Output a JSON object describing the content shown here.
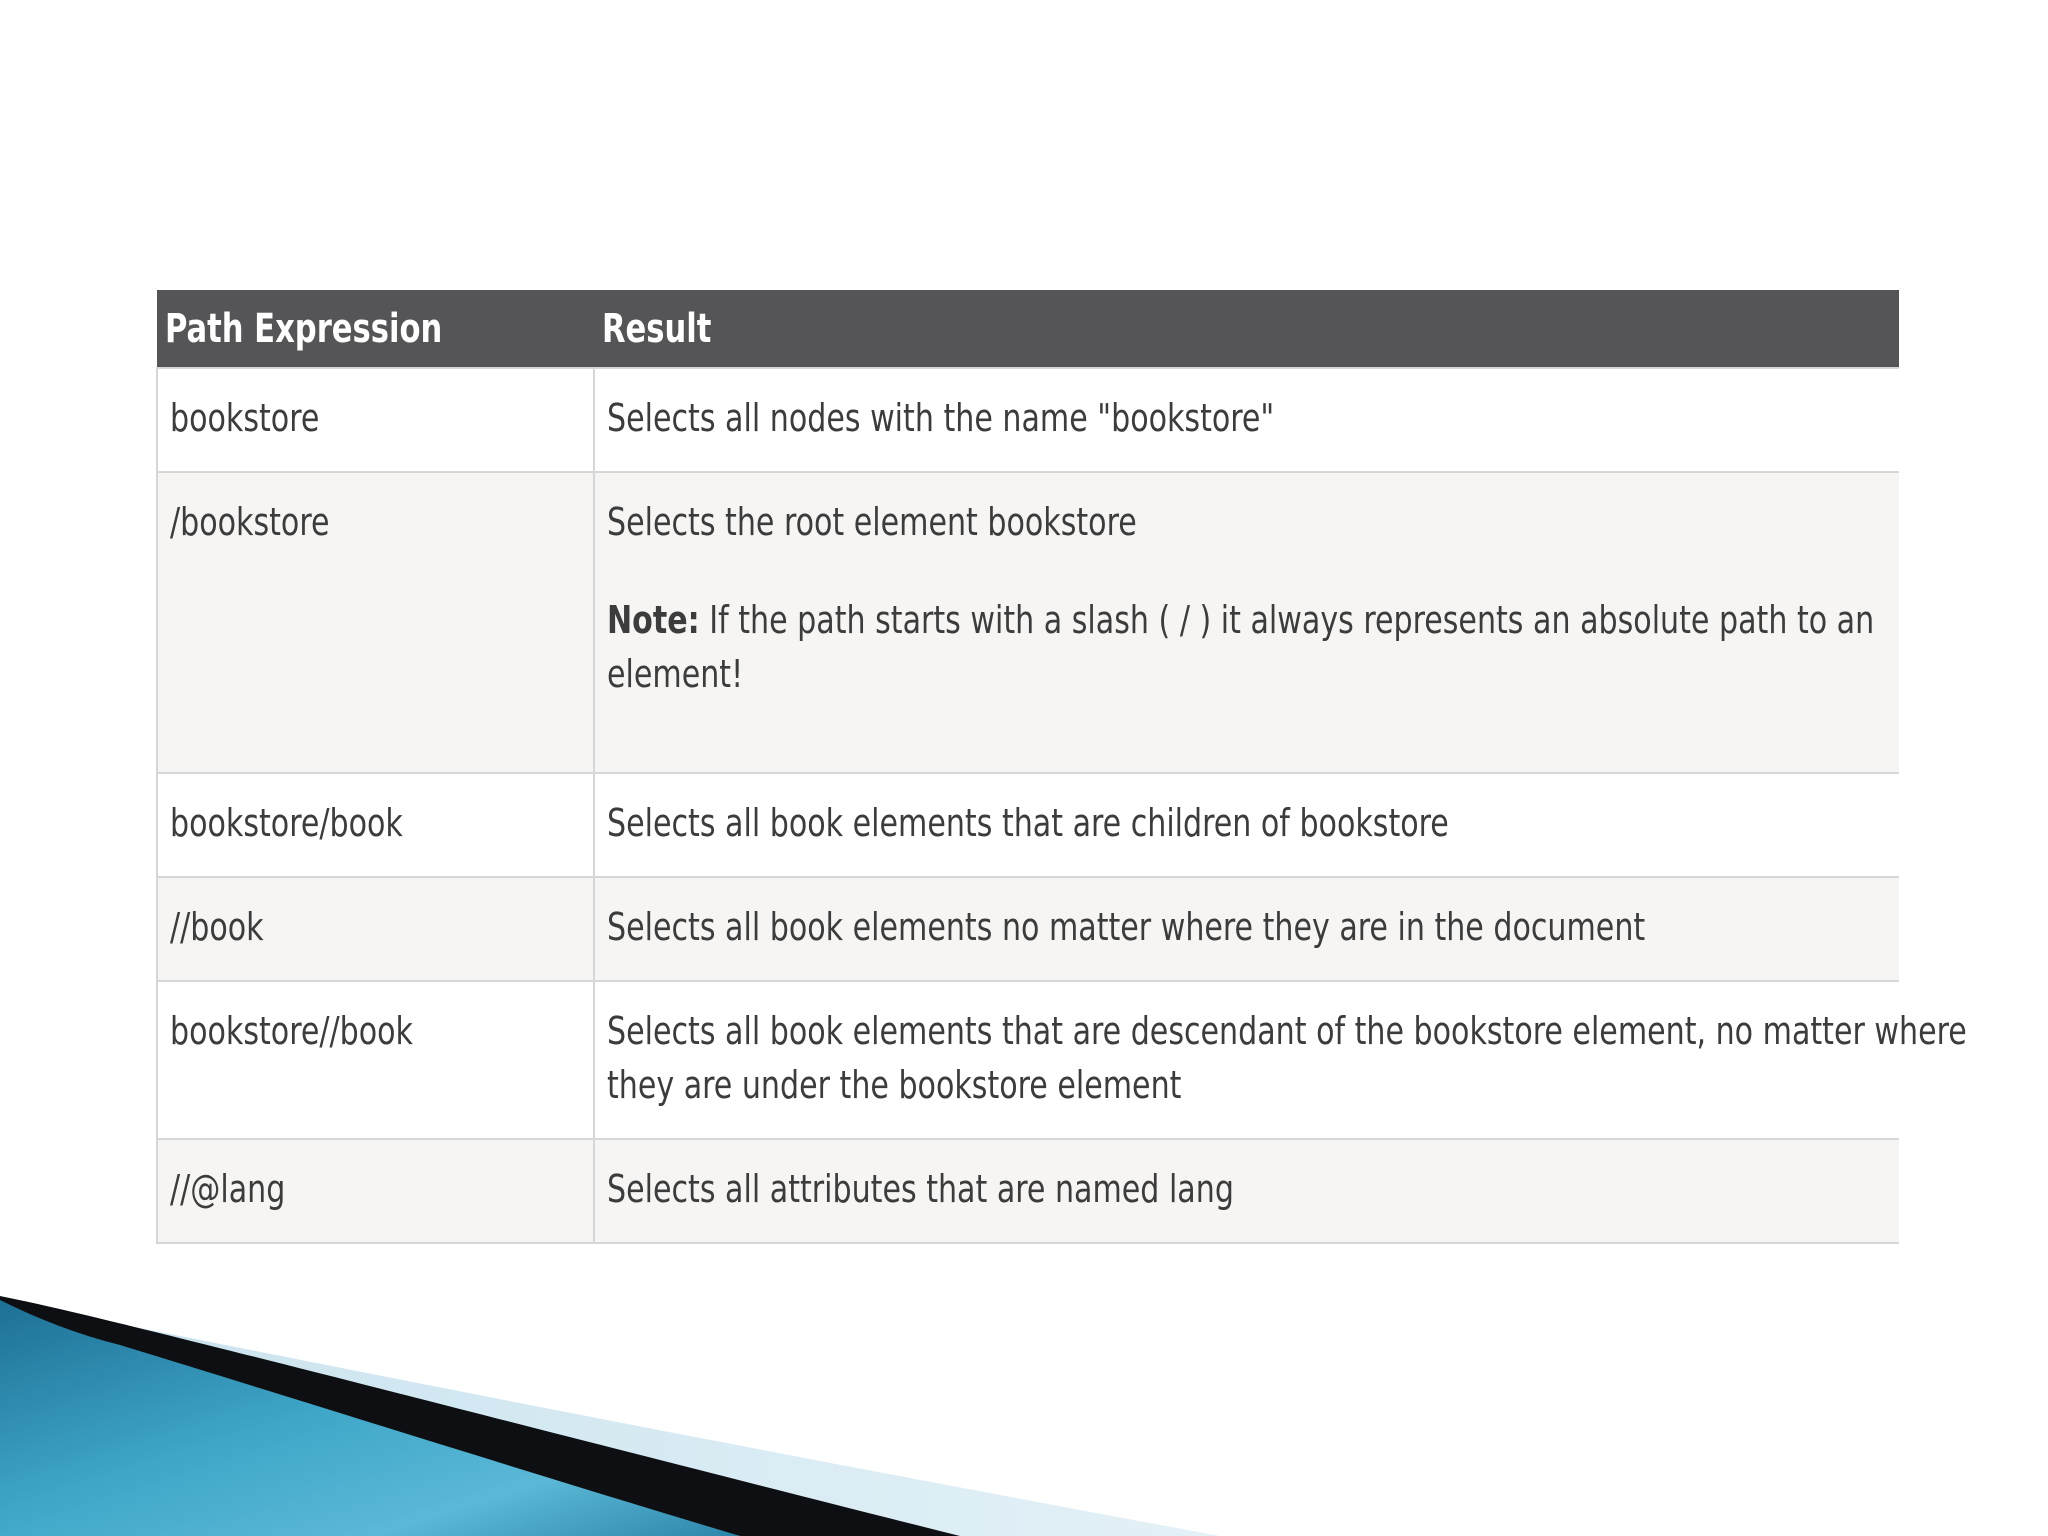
{
  "table": {
    "headers": [
      "Path Expression",
      "Result"
    ],
    "rows": [
      {
        "expression": "bookstore",
        "result": "Selects all nodes with the name \"bookstore\""
      },
      {
        "expression": "/bookstore",
        "result": "Selects the root element bookstore",
        "note_label": "Note:",
        "note_text": " If the path starts with a slash ( / ) it always represents an absolute path to an",
        "note_text_line2": "element!"
      },
      {
        "expression": "bookstore/book",
        "result": "Selects all book elements that are children of bookstore"
      },
      {
        "expression": "//book",
        "result": "Selects all book elements no matter where they are in the document"
      },
      {
        "expression": "bookstore//book",
        "result": "Selects all book elements that are descendant of the bookstore element, no matter where",
        "result_line2": "they are under the bookstore element"
      },
      {
        "expression": "//@lang",
        "result": "Selects all attributes that are named lang"
      }
    ]
  },
  "colors": {
    "header_bg": "#555456",
    "row_alt_bg": "#f6f5f3",
    "border": "#d6d6d6",
    "accent_blue": "#3fa6c8"
  }
}
